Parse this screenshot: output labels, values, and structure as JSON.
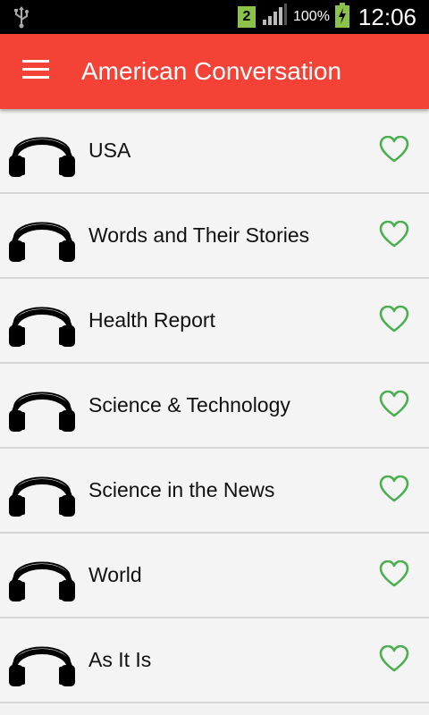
{
  "status_bar": {
    "sim_slot": "2",
    "battery": "100%",
    "time": "12:06"
  },
  "app_bar": {
    "title": "American Conversation",
    "menu_icon": "hamburger-menu-icon",
    "color": "#f44336"
  },
  "list": {
    "item_icon": "headphones-icon",
    "favorite_icon": "heart-outline-icon",
    "favorite_color": "#4caf50",
    "items": [
      {
        "label": "USA"
      },
      {
        "label": "Words and Their Stories"
      },
      {
        "label": "Health Report"
      },
      {
        "label": "Science & Technology"
      },
      {
        "label": "Science in the News"
      },
      {
        "label": "World"
      },
      {
        "label": "As It Is"
      }
    ]
  }
}
